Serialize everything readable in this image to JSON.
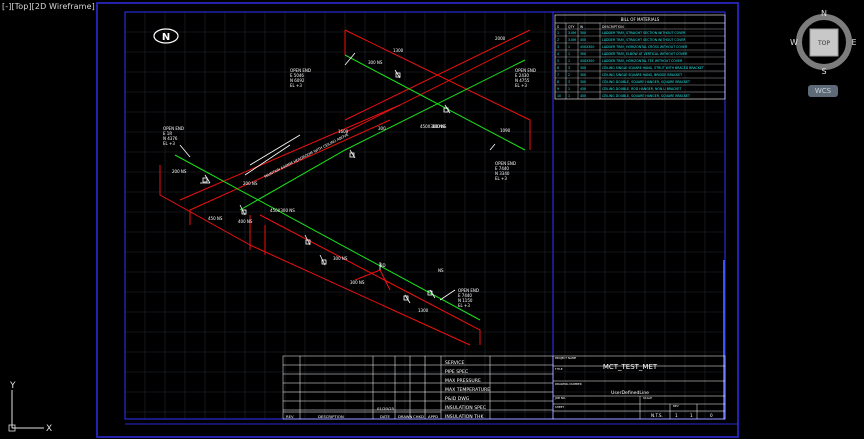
{
  "viewport": {
    "label": "[-][Top][2D Wireframe]"
  },
  "viewcube": {
    "north": "N",
    "south": "S",
    "east": "E",
    "west": "W",
    "face": "TOP",
    "wcs": "WCS"
  },
  "ucs": {
    "x": "X",
    "y": "Y"
  },
  "north_symbol": "N",
  "bom": {
    "title": "BILL OF MATERIALS",
    "columns": [
      "S",
      "QTY",
      "W",
      "DESCRIPTION"
    ],
    "rows": [
      [
        "1",
        "3.0M",
        "300",
        "LADDER TRAY, STRAIGHT SECTION WITHOUT COVER"
      ],
      [
        "2",
        "3.0M",
        "450",
        "LADDER TRAY, STRAIGHT SECTION WITHOUT COVER"
      ],
      [
        "3",
        "1",
        "450X300",
        "LADDER TRAY, HORIZONTAL CROSS WITHOUT COVER"
      ],
      [
        "4",
        "1",
        "300",
        "LADDER TRAY, ELBOW AT VERTICAL WITHOUT COVER"
      ],
      [
        "5",
        "1",
        "450X300",
        "LADDER TRAY, HORIZONTAL TEE WITHOUT COVER"
      ],
      [
        "6",
        "3",
        "300",
        "CEILING SINGLE SQUARE HANG, STRUT WITH BRACED BRACKET"
      ],
      [
        "7",
        "2",
        "300",
        "CEILING SINGLE SQUARE HANG, BRIDGE BRACKET"
      ],
      [
        "8",
        "3",
        "300",
        "CEILING DOUBLE, SQUARE HANGER, SQUARE BRACKET"
      ],
      [
        "9",
        "1",
        "450",
        "CEILING DOUBLE, ROD HANGER, NON-U BRACKET"
      ],
      [
        "10",
        "1",
        "450",
        "CEILING DOUBLE, SQUARE HANGER, SQUARE BRACKET"
      ]
    ]
  },
  "open_ends": [
    {
      "title": "OPEN END",
      "e": "E 5046",
      "n": "N 6092",
      "el": "EL +3"
    },
    {
      "title": "OPEN END",
      "e": "E 2430",
      "n": "N 4755",
      "el": "EL +3"
    },
    {
      "title": "OPEN END",
      "e": "E 1R",
      "n": "N 4376",
      "el": "EL +3"
    },
    {
      "title": "OPEN END",
      "e": "E 7440",
      "n": "N 3340",
      "el": "EL +3"
    },
    {
      "title": "OPEN END",
      "e": "E 7440",
      "n": "N 1150",
      "el": "EL +3"
    }
  ],
  "dims": [
    "300 NS",
    "300 NS",
    "450X300 NS",
    "300",
    "200 NS",
    "200 NS",
    "400 NS",
    "450X300 NS",
    "300 NS",
    "300 NS",
    "8D",
    "450 NS",
    "1300",
    "2000",
    "1600",
    "1090",
    "1300",
    "NS"
  ],
  "leader_note": "MAINTAIN 600MM HEADROOM WITH CEILING ABOVE",
  "title_block": {
    "service_rows": [
      "SERVICE",
      "PIPE SPEC",
      "MAX PRESSURE",
      "MAX TEMPERATURE",
      "P&ID DWG",
      "INSULATION SPEC",
      "INSULATION THK"
    ],
    "rev_headers": [
      "REV",
      "DESCRIPTION",
      "DATE",
      "DRAWN",
      "CHKD",
      "APPD"
    ],
    "rev_date": "01/20/25",
    "project_label": "PROJECT NAME",
    "project_name": "MCT_TEST_MET",
    "title_label": "TITLE",
    "drawing_label": "DRAWING NUMBER",
    "drawing_number": "UserDefinedLine",
    "job_label": "JOB NO.",
    "sheet_label": "SHEET",
    "scale_label": "SCALE",
    "scale": "N.T.S.",
    "rev_label": "REV",
    "sheet_num": "1",
    "sheet_of": "1",
    "rev_value": "0"
  }
}
